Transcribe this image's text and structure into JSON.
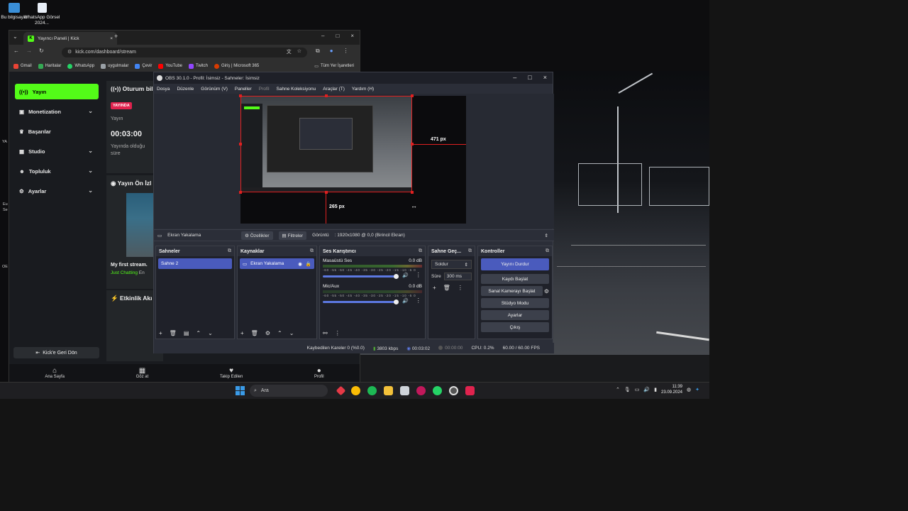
{
  "desktop": {
    "icons": [
      {
        "label": "Bu bilgisayar"
      },
      {
        "label": "WhatsApp Görsel 2024..."
      }
    ],
    "side_labels": [
      "YA",
      "Eu",
      "Se",
      "OE"
    ]
  },
  "chrome": {
    "tab_title": "Yayıncı Paneli | Kick",
    "tab_close": "×",
    "new_tab": "+",
    "url": "kick.com/dashboard/stream",
    "bookmarks": [
      "Gmail",
      "Haritalar",
      "WhatsApp",
      "uygulmalar",
      "Çevir",
      "YouTube",
      "Twitch",
      "Giriş | Microsoft 365"
    ],
    "all_bookmarks": "Tüm Yer İşaretleri",
    "window_controls": [
      "–",
      "□",
      "×"
    ]
  },
  "kick": {
    "sidebar": [
      {
        "label": "Yayın",
        "active": true
      },
      {
        "label": "Monetization",
        "chevron": true
      },
      {
        "label": "Başarılar",
        "chevron": false
      },
      {
        "label": "Studio",
        "chevron": true
      },
      {
        "label": "Topluluk",
        "chevron": true
      },
      {
        "label": "Ayarlar",
        "chevron": true
      }
    ],
    "back_button": "Kick'e Geri Dön",
    "session_title": "Oturum bilg",
    "live_badge": "YAYINDA",
    "stream_label": "Yayın",
    "timer": "00:03:00",
    "live_duration_label": "Yayında olduğu",
    "live_duration_label2": "süre",
    "preview_title": "Yayın Ön İzl",
    "stream_name": "My first stream.",
    "category": "Just Chatting",
    "category_extra": "En",
    "activity_title": "Etkinlik Akı",
    "bottom_nav": [
      "Ana Sayfa",
      "Göz at",
      "Takip Edilen",
      "Profil"
    ]
  },
  "obs": {
    "title": "OBS 30.1.0 - Profil: İsimsiz - Sahneler: İsimsiz",
    "window_controls": [
      "–",
      "□",
      "×"
    ],
    "menu": [
      "Dosya",
      "Düzenle",
      "Görünüm (V)",
      "Paneller",
      "Profil",
      "Sahne Koleksiyonu",
      "Araçlar (T)",
      "Yardım (H)"
    ],
    "dim_width": "471 px",
    "dim_height": "265 px",
    "source_bar": {
      "source": "Ekran Yakalama",
      "properties": "Özellikler",
      "filters": "Filtreler",
      "display_label": "Görüntü",
      "display_value": ": 1920x1080 @ 0,0 (Birincil Ekran)"
    },
    "scenes": {
      "title": "Sahneler",
      "items": [
        "Sahne 2"
      ]
    },
    "sources": {
      "title": "Kaynaklar",
      "items": [
        "Ekran Yakalama"
      ]
    },
    "mixer": {
      "title": "Ses Karıştırıcı",
      "channels": [
        {
          "name": "Masaüstü Ses",
          "db": "0.0 dB"
        },
        {
          "name": "Mic/Aux",
          "db": "0.0 dB"
        }
      ],
      "ticks": "-60 -55 -50 -45 -40 -35 -30 -25 -20 -15 -10 -5 0"
    },
    "transitions": {
      "title": "Sahne Geç...",
      "type": "Soldur",
      "duration_label": "Süre",
      "duration": "300 ms"
    },
    "controls": {
      "title": "Kontroller",
      "buttons": [
        "Yayını Durdur",
        "Kaydı Başlat",
        "Sanal Kamerayı Başlat",
        "Stüdyo Modu",
        "Ayarlar",
        "Çıkış"
      ]
    },
    "status": {
      "dropped": "Kaybedilen Kareler 0 (%0.0)",
      "bitrate": "3803 kbps",
      "stream_time": "00:03:02",
      "rec_time": "00:00:00",
      "cpu": "CPU: 0.2%",
      "fps": "60.00 / 60.00 FPS"
    }
  },
  "taskbar": {
    "search": "Ara",
    "time": "11:39",
    "date": "23.09.2024"
  },
  "colors": {
    "kick_green": "#53fc18",
    "obs_accent": "#4a5bbd",
    "live_red": "#e0234e",
    "selection_red": "#e02020"
  }
}
